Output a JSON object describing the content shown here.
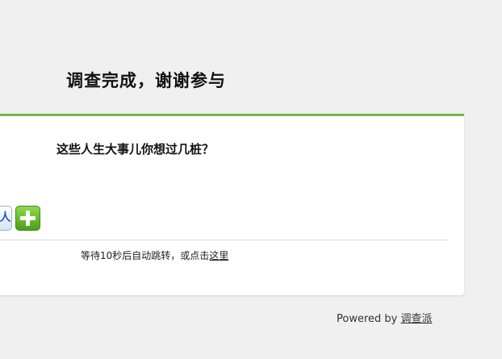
{
  "header": {
    "title": "调查完成，谢谢参与"
  },
  "card": {
    "survey_title": "这些人生大事儿你想过几桩？",
    "share_icons": [
      {
        "icon": "renren-icon",
        "glyph": "人"
      },
      {
        "icon": "add-icon"
      }
    ],
    "redirect": {
      "text": "等待10秒后自动跳转，或点击",
      "link_label": "这里"
    }
  },
  "footer": {
    "powered_by": "Powered by ",
    "brand": "调查派"
  },
  "colors": {
    "accent": "#7ab648",
    "background": "#f0f0f0",
    "card": "#ffffff"
  }
}
